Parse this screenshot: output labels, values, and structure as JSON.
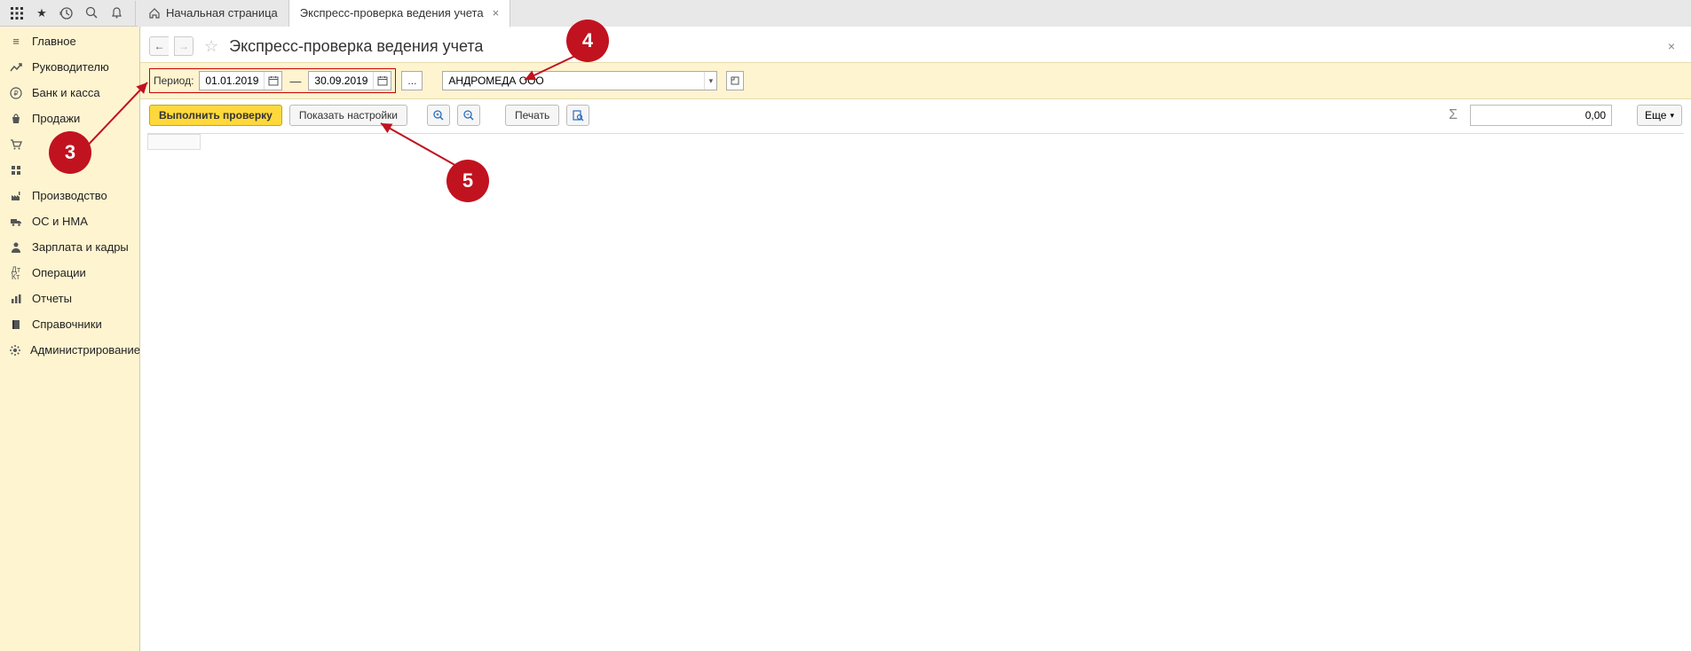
{
  "tabs": {
    "home": "Начальная страница",
    "active": "Экспресс-проверка ведения учета"
  },
  "sidebar": {
    "items": [
      {
        "label": "Главное"
      },
      {
        "label": "Руководителю"
      },
      {
        "label": "Банк и касса"
      },
      {
        "label": "Продажи"
      },
      {
        "label": ""
      },
      {
        "label": ""
      },
      {
        "label": "Производство"
      },
      {
        "label": "ОС и НМА"
      },
      {
        "label": "Зарплата и кадры"
      },
      {
        "label": "Операции"
      },
      {
        "label": "Отчеты"
      },
      {
        "label": "Справочники"
      },
      {
        "label": "Администрирование"
      }
    ]
  },
  "page": {
    "title": "Экспресс-проверка ведения учета"
  },
  "filter": {
    "period_label": "Период:",
    "date_from": "01.01.2019",
    "date_to": "30.09.2019",
    "dash": "—",
    "dots": "...",
    "org": "АНДРОМЕДА ООО"
  },
  "actions": {
    "run": "Выполнить проверку",
    "show_settings": "Показать настройки",
    "print": "Печать",
    "more": "Еще",
    "sum_value": "0,00"
  },
  "annotations": {
    "n3": "3",
    "n4": "4",
    "n5": "5"
  }
}
